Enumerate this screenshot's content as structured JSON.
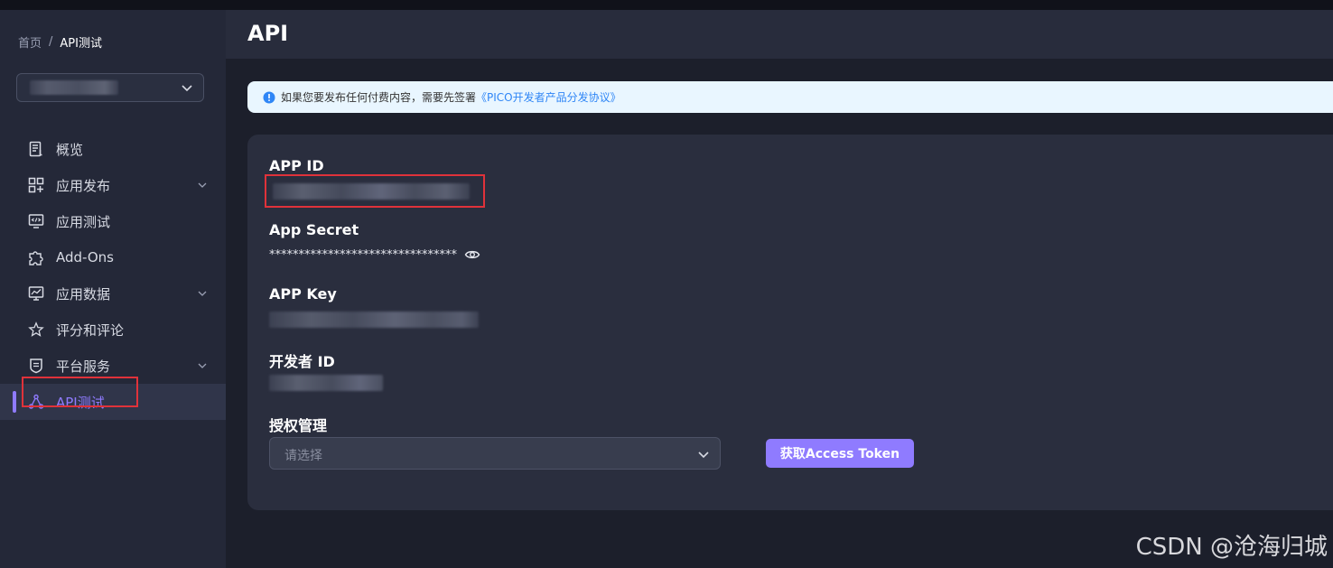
{
  "breadcrumb": {
    "home": "首页",
    "separator": "/",
    "current": "API测试"
  },
  "sidebar": {
    "app_selector": {
      "value_redacted": true
    },
    "items": [
      {
        "label": "概览",
        "icon": "document-icon",
        "expandable": false
      },
      {
        "label": "应用发布",
        "icon": "grid-plus-icon",
        "expandable": true
      },
      {
        "label": "应用测试",
        "icon": "monitor-code-icon",
        "expandable": false
      },
      {
        "label": "Add-Ons",
        "icon": "puzzle-icon",
        "expandable": false
      },
      {
        "label": "应用数据",
        "icon": "chart-monitor-icon",
        "expandable": true
      },
      {
        "label": "评分和评论",
        "icon": "star-icon",
        "expandable": false
      },
      {
        "label": "平台服务",
        "icon": "shield-icon",
        "expandable": true
      },
      {
        "label": "API测试",
        "icon": "nodes-icon",
        "expandable": false,
        "active": true
      }
    ]
  },
  "header": {
    "title": "API"
  },
  "notice": {
    "text": "如果您要发布任何付费内容，需要先签署",
    "link": "《PICO开发者产品分发协议》"
  },
  "card": {
    "app_id_label": "APP ID",
    "app_secret_label": "App Secret",
    "app_secret_masked": "********************************",
    "app_key_label": "APP Key",
    "developer_id_label": "开发者 ID",
    "auth_label": "授权管理",
    "auth_placeholder": "请选择",
    "token_button": "获取Access Token"
  },
  "watermark": "CSDN @沧海归城",
  "colors": {
    "accent": "#8f7bff",
    "highlight": "#e0323a",
    "link": "#2f86f6"
  }
}
